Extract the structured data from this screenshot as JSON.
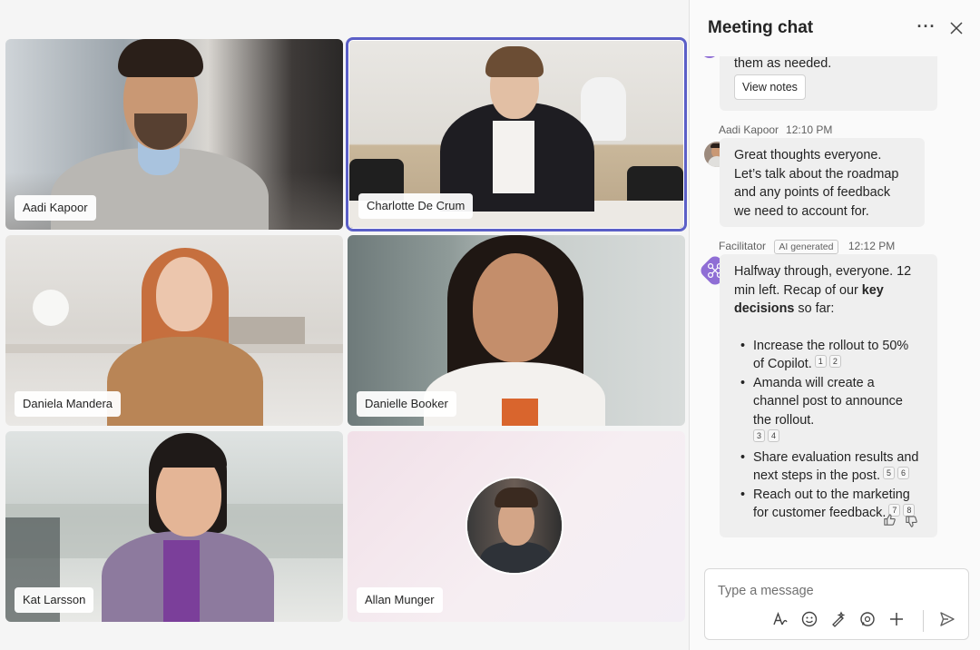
{
  "participants": [
    {
      "name": "Aadi Kapoor"
    },
    {
      "name": "Charlotte De Crum"
    },
    {
      "name": "Daniela Mandera"
    },
    {
      "name": "Danielle Booker"
    },
    {
      "name": "Kat Larsson"
    },
    {
      "name": "Allan Munger"
    }
  ],
  "chat": {
    "title": "Meeting chat",
    "more_icon": "more-horizontal-icon",
    "close_icon": "close-icon",
    "messages": {
      "partial": {
        "text": "them as needed.",
        "button": "View notes"
      },
      "aadi": {
        "sender": "Aadi Kapoor",
        "time": "12:10 PM",
        "text": "Great thoughts everyone. Let’s talk about the roadmap and any points of feedback we need to account for."
      },
      "facilitator": {
        "sender": "Facilitator",
        "badge": "AI generated",
        "time": "12:12 PM",
        "intro_1": "Halfway through, everyone. 12 min left. Recap of our ",
        "intro_bold": "key decisions",
        "intro_2": " so far:",
        "bullets": [
          {
            "text": "Increase the rollout to 50% of Copilot.",
            "cites": [
              "1",
              "2"
            ]
          },
          {
            "text": "Amanda will create a channel post to announce the rollout.",
            "cites": [
              "3",
              "4"
            ]
          },
          {
            "text": "Share evaluation results and next steps in the post.",
            "cites": [
              "5",
              "6"
            ]
          },
          {
            "text": "Reach out to the marketing for customer feedback.",
            "cites": [
              "7",
              "8"
            ]
          }
        ]
      }
    },
    "composer": {
      "placeholder": "Type a message"
    }
  },
  "colors": {
    "accent": "#5b5fc7",
    "panel_bg": "#fafafa",
    "bubble_bg": "#efefef"
  }
}
